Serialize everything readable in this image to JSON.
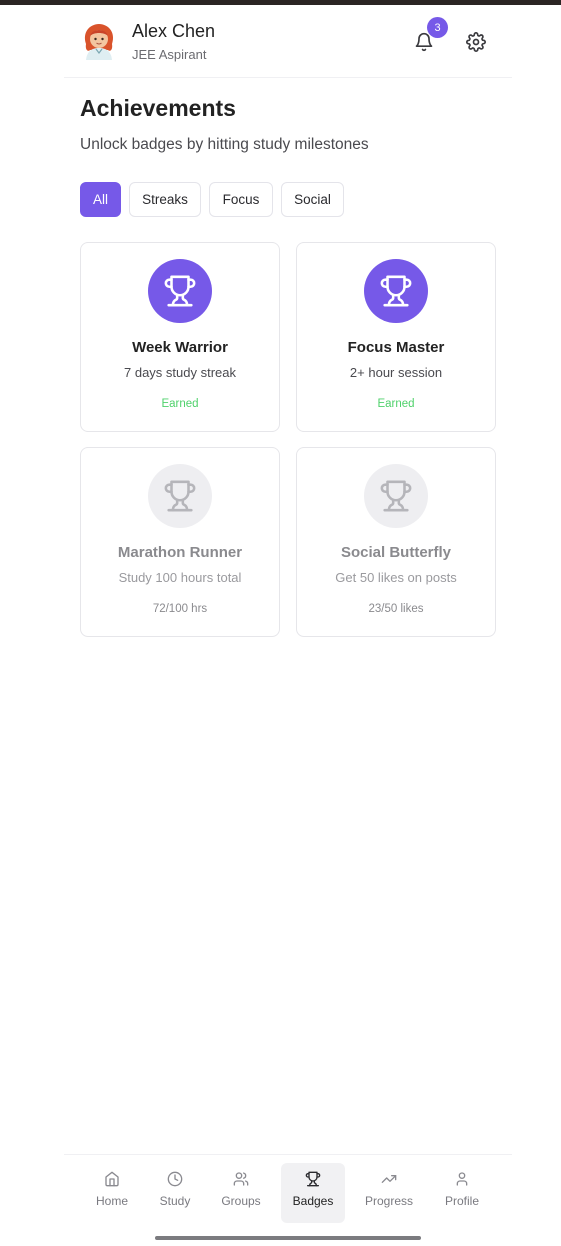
{
  "user": {
    "name": "Alex Chen",
    "role": "JEE Aspirant",
    "notification_count": "3"
  },
  "page": {
    "title": "Achievements",
    "subtitle": "Unlock badges by hitting study milestones"
  },
  "filters": [
    {
      "label": "All",
      "active": true
    },
    {
      "label": "Streaks",
      "active": false
    },
    {
      "label": "Focus",
      "active": false
    },
    {
      "label": "Social",
      "active": false
    }
  ],
  "badges": [
    {
      "title": "Week Warrior",
      "description": "7 days study streak",
      "status": "Earned",
      "earned": true,
      "icon": "trophy-icon"
    },
    {
      "title": "Focus Master",
      "description": "2+ hour session",
      "status": "Earned",
      "earned": true,
      "icon": "trophy-icon"
    },
    {
      "title": "Marathon Runner",
      "description": "Study 100 hours total",
      "status": "72/100 hrs",
      "earned": false,
      "icon": "trophy-icon"
    },
    {
      "title": "Social Butterfly",
      "description": "Get 50 likes on posts",
      "status": "23/50 likes",
      "earned": false,
      "icon": "trophy-icon"
    }
  ],
  "nav": [
    {
      "label": "Home",
      "icon": "home-icon",
      "active": false
    },
    {
      "label": "Study",
      "icon": "clock-icon",
      "active": false
    },
    {
      "label": "Groups",
      "icon": "users-icon",
      "active": false
    },
    {
      "label": "Badges",
      "icon": "trophy-icon",
      "active": true
    },
    {
      "label": "Progress",
      "icon": "trending-up-icon",
      "active": false
    },
    {
      "label": "Profile",
      "icon": "user-icon",
      "active": false
    }
  ],
  "colors": {
    "accent": "#7659e8",
    "earned_text": "#4fd16b",
    "locked_bg": "#eeeef1"
  }
}
